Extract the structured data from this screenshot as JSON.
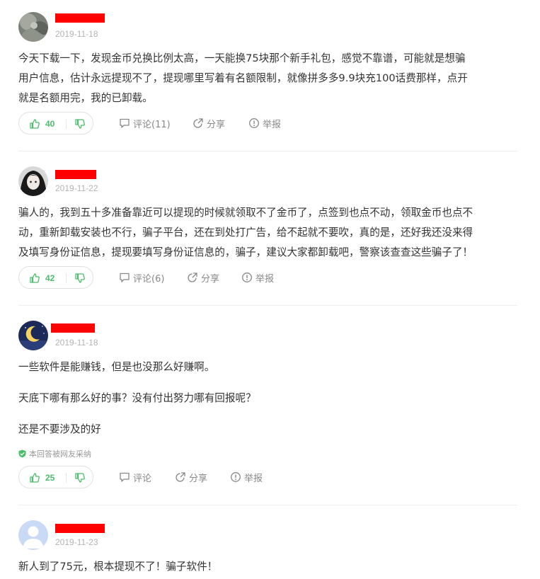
{
  "answers": [
    {
      "date": "2019-11-18",
      "paragraphs": [
        "今天下载一下，发现金币兑换比例太高，一天能换75块那个新手礼包，感觉不靠谱，可能就是想骗",
        "用户信息，估计永远提现不了，提现哪里写着有名额限制，就像拼多多9.9块充100话费那样，点开",
        "就是名额用完，我的已卸载。"
      ],
      "likes": "40",
      "comment_label": "评论(11)",
      "share_label": "分享",
      "report_label": "举报"
    },
    {
      "date": "2019-11-22",
      "paragraphs": [
        "骗人的，我到五十多准备靠近可以提现的时候就领取不了金币了，点签到也点不动，领取金币也点不",
        "动，重新卸载安装也不行，骗子平台，还在到处打广告，给不起就不要吹，真的是，还好我还没来得",
        "及填写身份证信息，提现要填写身份证信息的，骗子，建议大家都卸载吧，警察该查查这些骗子了！"
      ],
      "likes": "42",
      "comment_label": "评论(6)",
      "share_label": "分享",
      "report_label": "举报"
    },
    {
      "date": "2019-11-18",
      "paragraphs": [
        "一些软件是能赚钱，但是也没那么好赚啊。",
        "天底下哪有那么好的事？没有付出努力哪有回报呢？",
        "还是不要涉及的好"
      ],
      "adopted": "本回答被网友采纳",
      "likes": "25",
      "comment_label": "评论",
      "share_label": "分享",
      "report_label": "举报"
    },
    {
      "date": "2019-11-23",
      "paragraphs": [
        "新人到了75元，根本提现不了！骗子软件！"
      ]
    }
  ],
  "colors": {
    "like_green": "#4cbd6a",
    "redaction": "#ff0000",
    "date_gray": "#b3b3b3"
  },
  "icons": [
    "thumb-up-icon",
    "thumb-down-icon",
    "comment-icon",
    "share-icon",
    "report-icon",
    "shield-check-icon"
  ]
}
